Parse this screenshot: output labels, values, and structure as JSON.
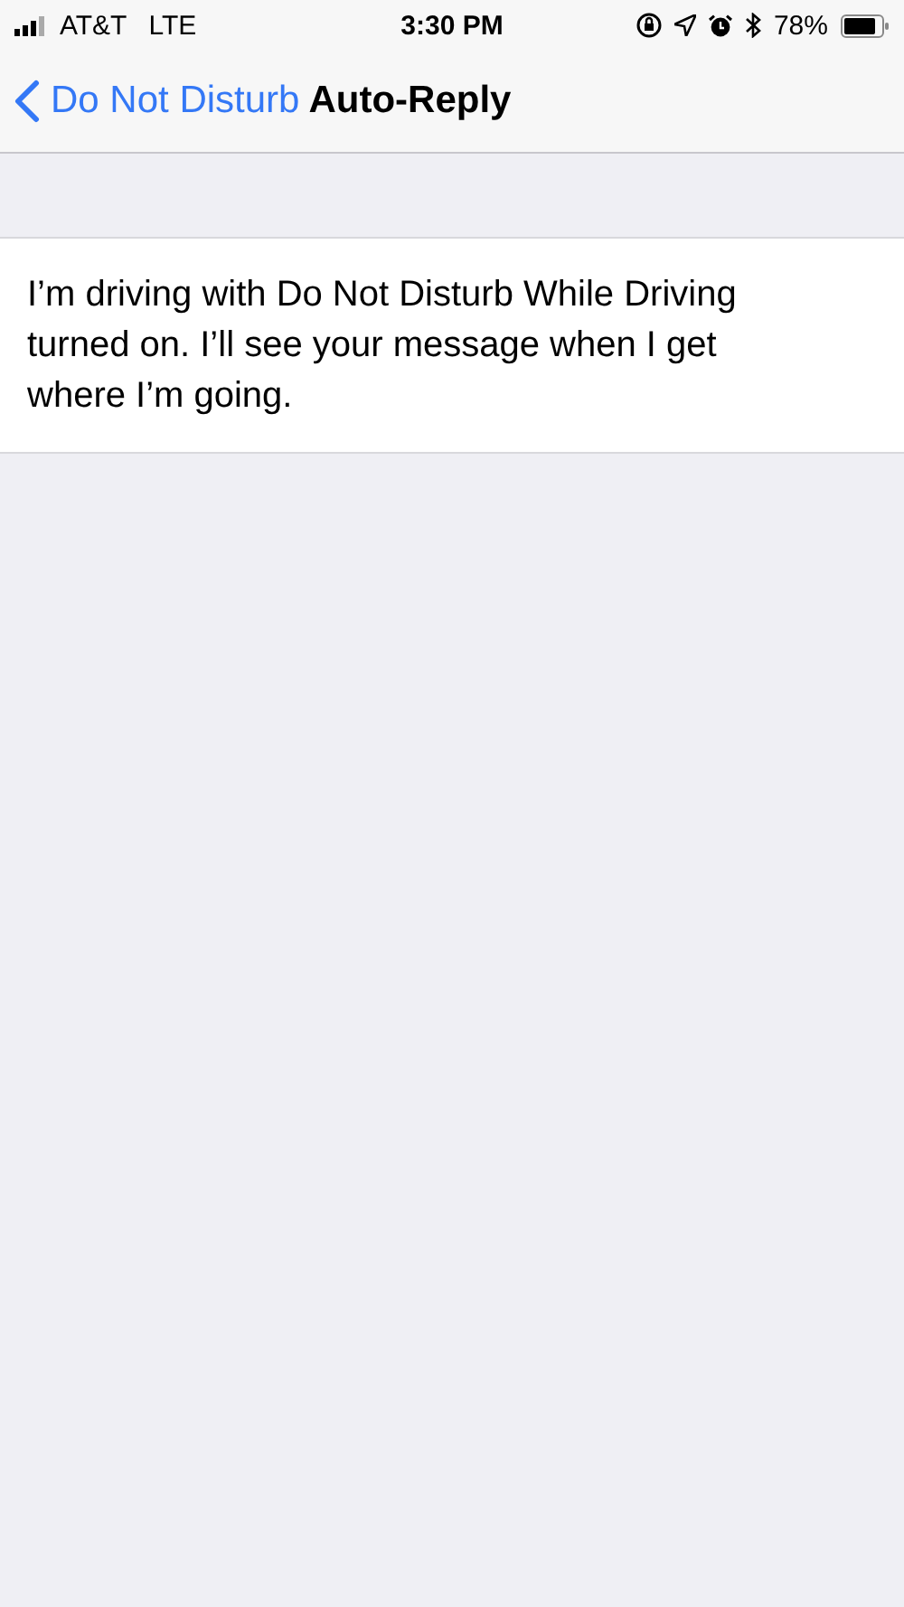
{
  "status_bar": {
    "carrier": "AT&T",
    "network": "LTE",
    "time": "3:30 PM",
    "battery": "78%"
  },
  "nav_bar": {
    "back": "Do Not Disturb",
    "title": "Auto-Reply"
  },
  "message": {
    "value": "I’m driving with Do Not Disturb While Driving turned on. I’ll see your message when I get where I’m going."
  }
}
